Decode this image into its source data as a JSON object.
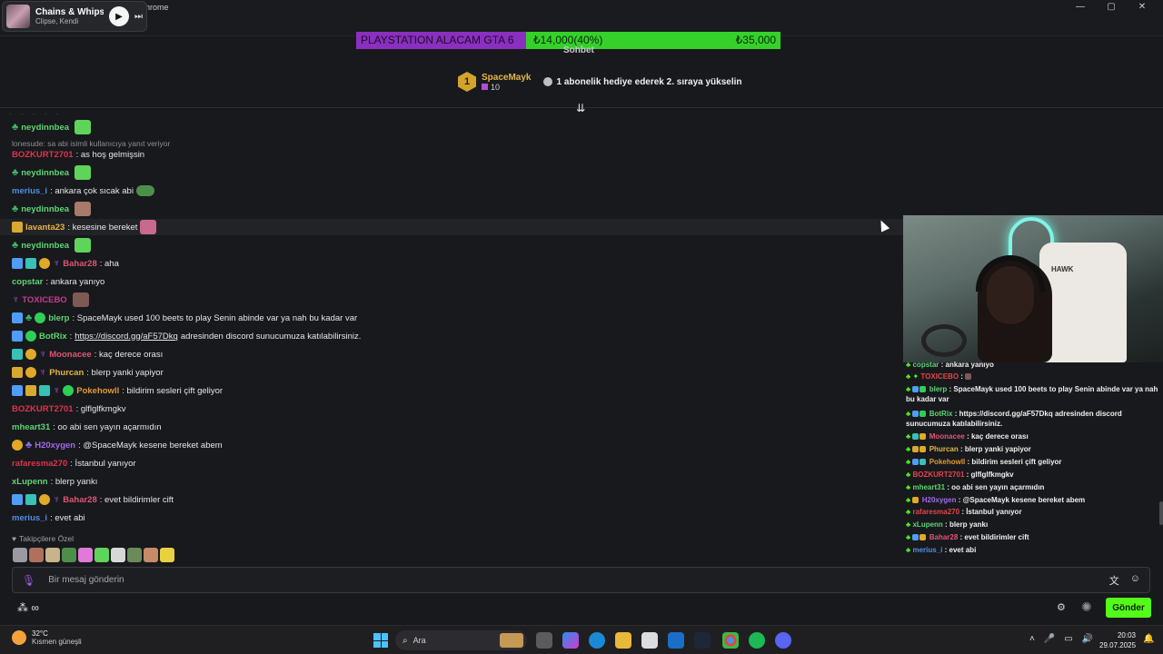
{
  "window": {
    "title_fragment": "hrome",
    "controls": [
      "—",
      "▢",
      "✕"
    ]
  },
  "media": {
    "title": "Chains & Whips",
    "subtitle": "Clipse, Kendi"
  },
  "goal": {
    "label": "PLAYSTATION ALACAM GTA 6",
    "current": "₺14,000(40%)",
    "target": "₺35,000",
    "progress": 0.4
  },
  "chat_tab": "Sohbet",
  "gifter": {
    "rank": "1",
    "name": "SpaceMayk",
    "count": "10",
    "message": "1 abonelik hediye ederek 2. sıraya yükselin"
  },
  "reply_context": "lonesude: sa abi isimli kullanıcıya yanıt veriyor",
  "messages": [
    {
      "user": "neydinnbea",
      "text": "",
      "color": "#5dd672"
    },
    {
      "user": "BOZKURT2701",
      "text": ": as hoş gelmişsin",
      "color": "#e0334b"
    },
    {
      "user": "neydinnbea",
      "text": "",
      "color": "#5dd672"
    },
    {
      "user": "merius_i",
      "text": ": ankara çok sıcak abi",
      "color": "#4f8fe8"
    },
    {
      "user": "neydinnbea",
      "text": "",
      "color": "#5dd672"
    },
    {
      "user": "lavanta23",
      "text": ": kesesine bereket",
      "color": "#e6b548"
    },
    {
      "user": "neydinnbea",
      "text": "",
      "color": "#5dd672"
    },
    {
      "user": "Bahar28",
      "text": ": aha",
      "color": "#e05576"
    },
    {
      "user": "copstar",
      "text": ": ankara yanıyo",
      "color": "#5dd672"
    },
    {
      "user": "TOXICEBO",
      "text": "",
      "color": "#c33b8c"
    },
    {
      "user": "blerp",
      "text": ": SpaceMayk used 100 beets to play Senin abinde var ya nah bu kadar var",
      "color": "#5dd672"
    },
    {
      "user": "BotRix",
      "text": ": ",
      "link": "https://discord.gg/aF57Dkq",
      "after": " adresinden discord sunucumuza katılabilirsiniz.",
      "color": "#5dd672"
    },
    {
      "user": "Moonacee",
      "text": ": kaç derece orası",
      "color": "#e05576"
    },
    {
      "user": "Phurcan",
      "text": ": blerp yanki yapiyor",
      "color": "#e6b548"
    },
    {
      "user": "Pokehowll",
      "text": ": bildirim sesleri çift geliyor",
      "color": "#e09a34"
    },
    {
      "user": "BOZKURT2701",
      "text": ": glflglfkmgkv",
      "color": "#e0334b"
    },
    {
      "user": "mheart31",
      "text": ": oo abi sen yayın açarmıdın",
      "color": "#5dd672"
    },
    {
      "user": "H20xygen",
      "text": ": @SpaceMayk kesene bereket abem",
      "color": "#a06be8"
    },
    {
      "user": "rafaresma270",
      "text": ": İstanbul yanıyor",
      "color": "#e0334b"
    },
    {
      "user": "xLupenn",
      "text": ": blerp yankı",
      "color": "#5dd672"
    },
    {
      "user": "Bahar28",
      "text": ": evet bildirimler cift",
      "color": "#e05576"
    },
    {
      "user": "merius_i",
      "text": ": evet abi",
      "color": "#4f8fe8"
    }
  ],
  "followers_label": "Takipçilere Özel",
  "input": {
    "placeholder": "Bir mesaj gönderin",
    "send": "Gönder"
  },
  "overlay": [
    {
      "user": "copstar",
      "text": " : ankara yanıyo"
    },
    {
      "user": "TOXICEBO",
      "text": " :"
    },
    {
      "user": "blerp",
      "text": " : SpaceMayk used 100 beets to play Senin abinde var ya nah bu kadar var"
    },
    {
      "user": "BotRix",
      "text": " : https://discord.gg/aF57Dkq adresinden discord sunucumuza katılabilirsiniz."
    },
    {
      "user": "Moonacee",
      "text": " : kaç derece orası"
    },
    {
      "user": "Phurcan",
      "text": " : blerp yanki yapiyor"
    },
    {
      "user": "Pokehowll",
      "text": " : bildirim sesleri çift geliyor"
    },
    {
      "user": "BOZKURT2701",
      "text": " : glflglfkmgkv"
    },
    {
      "user": "mheart31",
      "text": " : oo abi sen yayın açarmıdın"
    },
    {
      "user": "H20xygen",
      "text": " : @SpaceMayk kesene bereket abem"
    },
    {
      "user": "rafaresma270",
      "text": " : İstanbul yanıyor"
    },
    {
      "user": "xLupenn",
      "text": " : blerp yankı"
    },
    {
      "user": "Bahar28",
      "text": " : evet bildirimler cift"
    },
    {
      "user": "merius_i",
      "text": " : evet abi"
    }
  ],
  "cam_logo": "HAWK",
  "taskbar": {
    "temp": "32°C",
    "weather": "Kısmen güneşli",
    "search": "Ara",
    "time": "20:03",
    "date": "29.07.2025"
  },
  "colors": {
    "accent": "#53fc18",
    "goal_purple": "#8a2fbf",
    "goal_green": "#35d12a"
  }
}
